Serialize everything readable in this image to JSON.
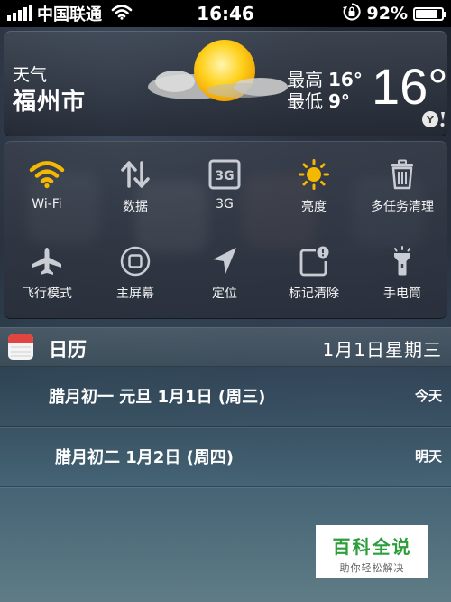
{
  "status_bar": {
    "carrier": "中国联通",
    "time": "16:46",
    "battery_percent": "92%",
    "battery_level": 0.92,
    "icons": [
      "signal-icon",
      "wifi-icon",
      "rotation-lock-icon",
      "battery-icon"
    ]
  },
  "weather": {
    "label": "天气",
    "city": "福州市",
    "high_label": "最高",
    "high_value": "16°",
    "low_label": "最低",
    "low_value": "9°",
    "current_temp": "16°",
    "condition_icon": "sun-cloud-icon",
    "provider_icon": "yahoo-icon"
  },
  "toggles": [
    {
      "label": "Wi-Fi",
      "icon": "wifi-icon",
      "active": true
    },
    {
      "label": "数据",
      "icon": "data-arrows-icon",
      "active": false
    },
    {
      "label": "3G",
      "icon": "3g-icon",
      "active": false
    },
    {
      "label": "亮度",
      "icon": "brightness-icon",
      "active": true
    },
    {
      "label": "多任务清理",
      "icon": "trash-icon",
      "active": false
    },
    {
      "label": "飞行模式",
      "icon": "airplane-icon",
      "active": false
    },
    {
      "label": "主屏幕",
      "icon": "home-button-icon",
      "active": false
    },
    {
      "label": "定位",
      "icon": "location-arrow-icon",
      "active": false
    },
    {
      "label": "标记清除",
      "icon": "badge-clear-icon",
      "active": false
    },
    {
      "label": "手电筒",
      "icon": "flashlight-icon",
      "active": false
    }
  ],
  "calendar": {
    "title": "日历",
    "date": "1月1日星期三",
    "events": [
      {
        "text": "腊月初一 元旦 1月1日 (周三)",
        "when": "今天"
      },
      {
        "text": "腊月初二 1月2日 (周四)",
        "when": "明天"
      }
    ]
  },
  "watermark": {
    "title": "百科全说",
    "subtitle": "助你轻松解决"
  },
  "colors": {
    "active_toggle": "#f5b800",
    "inactive_toggle": "#c9cdd3",
    "watermark_green": "#2d9e3c"
  }
}
